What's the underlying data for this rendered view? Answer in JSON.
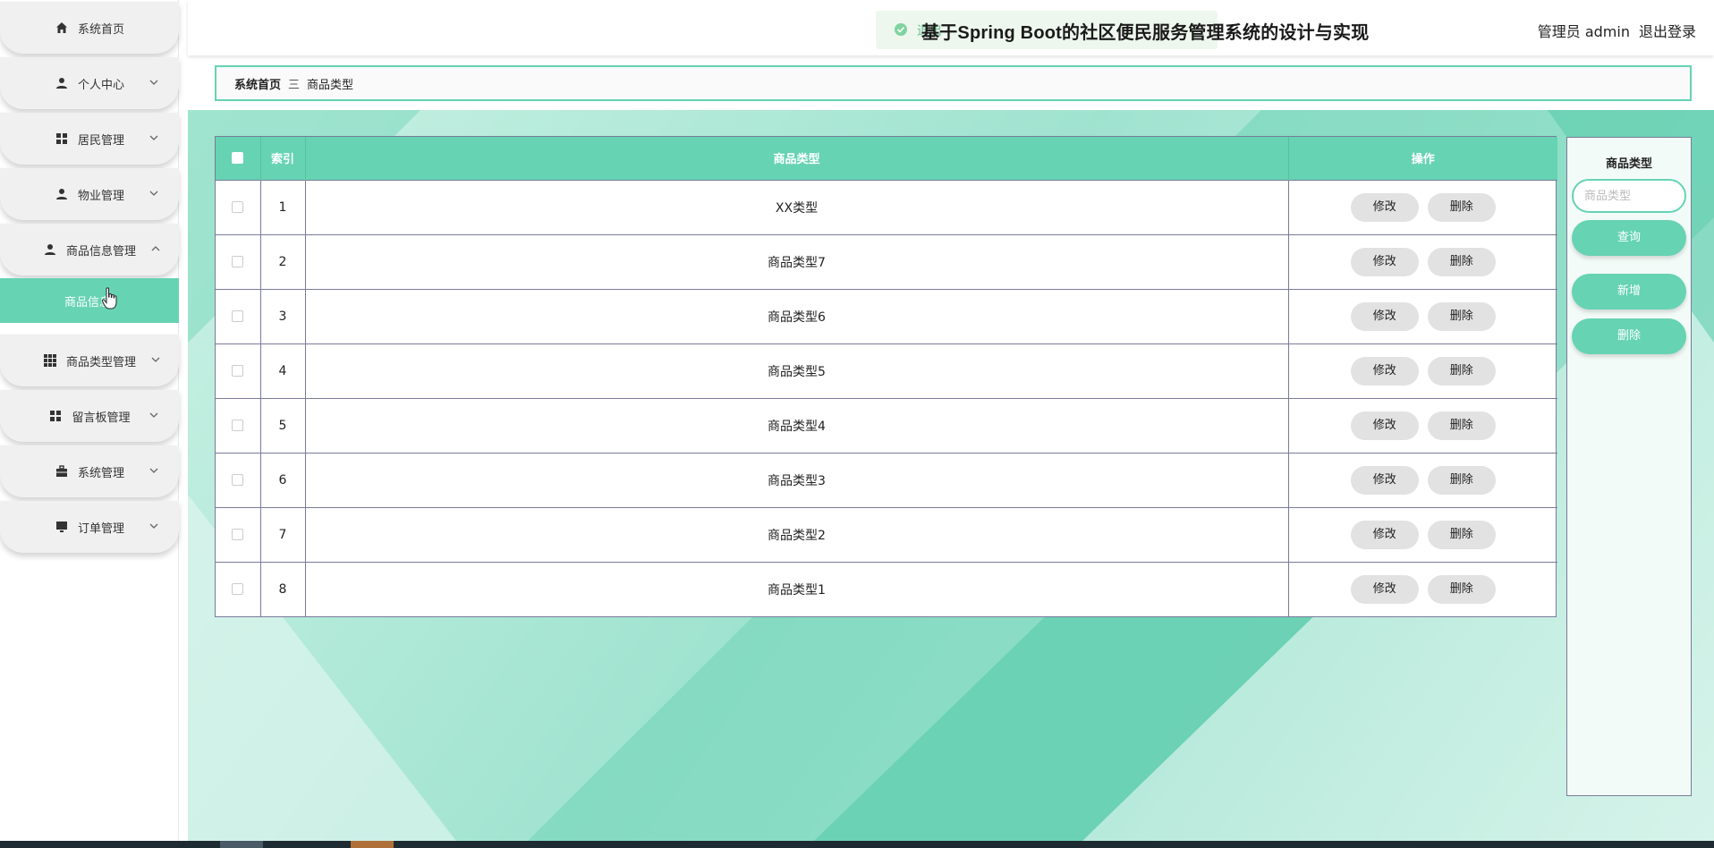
{
  "app": {
    "title": "基于Spring Boot的社区便民服务管理系统的设计与实现",
    "toast_text": "退出",
    "user_label": "管理员 admin",
    "logout_label": "退出登录"
  },
  "sidebar": {
    "items": [
      {
        "label": "系统首页",
        "icon": "home-icon"
      },
      {
        "label": "个人中心",
        "icon": "user-icon"
      },
      {
        "label": "居民管理",
        "icon": "grid-icon"
      },
      {
        "label": "物业管理",
        "icon": "user-icon"
      },
      {
        "label": "商品信息管理",
        "icon": "user-icon"
      },
      {
        "label": "商品类型管理",
        "icon": "apps-icon"
      },
      {
        "label": "留言板管理",
        "icon": "grid-icon"
      },
      {
        "label": "系统管理",
        "icon": "briefcase-icon"
      },
      {
        "label": "订单管理",
        "icon": "monitor-icon"
      }
    ],
    "sub_item": "商品信息"
  },
  "breadcrumb": {
    "home": "系统首页",
    "separator": "三",
    "current": "商品类型"
  },
  "table": {
    "headers": {
      "index": "索引",
      "type": "商品类型",
      "actions": "操作"
    },
    "rows": [
      {
        "index": "1",
        "type": "XX类型"
      },
      {
        "index": "2",
        "type": "商品类型7"
      },
      {
        "index": "3",
        "type": "商品类型6"
      },
      {
        "index": "4",
        "type": "商品类型5"
      },
      {
        "index": "5",
        "type": "商品类型4"
      },
      {
        "index": "6",
        "type": "商品类型3"
      },
      {
        "index": "7",
        "type": "商品类型2"
      },
      {
        "index": "8",
        "type": "商品类型1"
      }
    ],
    "edit_label": "修改",
    "delete_label": "删除"
  },
  "search_panel": {
    "label": "商品类型",
    "placeholder": "商品类型",
    "query_label": "查询",
    "add_label": "新增",
    "delete_label": "删除"
  },
  "colors": {
    "accent": "#66d3b3",
    "button_gray": "#e2e2e2"
  }
}
